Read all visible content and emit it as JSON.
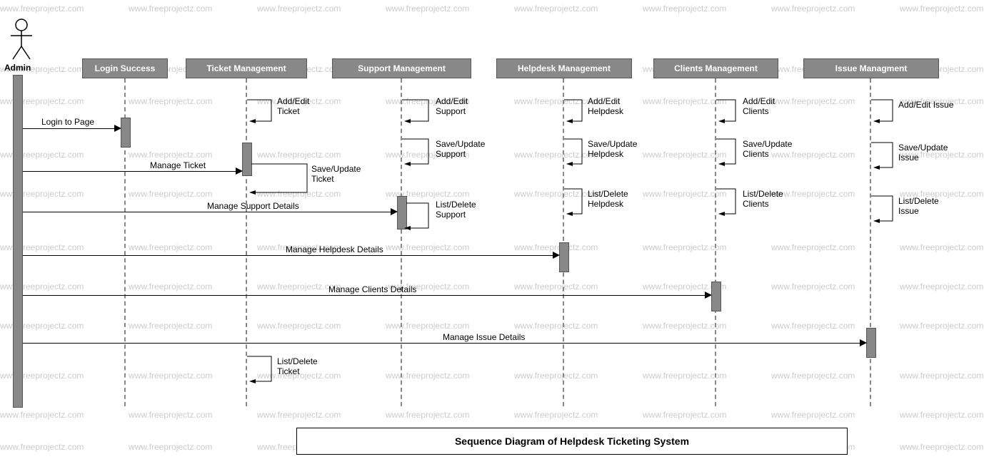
{
  "actor": {
    "name": "Admin"
  },
  "lifelines": [
    {
      "label": "Login Success"
    },
    {
      "label": "Ticket Management"
    },
    {
      "label": "Support Management"
    },
    {
      "label": "Helpdesk Management"
    },
    {
      "label": "Clients Management"
    },
    {
      "label": "Issue Managment"
    }
  ],
  "messages": {
    "login": "Login to Page",
    "manage_ticket": "Manage Ticket",
    "manage_support": "Manage Support Details",
    "manage_helpdesk": "Manage Helpdesk Details",
    "manage_clients": "Manage Clients Details",
    "manage_issue": "Manage Issue Details"
  },
  "self_calls": {
    "ticket_add": "Add/Edit\nTicket",
    "ticket_save": "Save/Update\nTicket",
    "ticket_list": "List/Delete\nTicket",
    "support_add": "Add/Edit\nSupport",
    "support_save": "Save/Update\nSupport",
    "support_list": "List/Delete\nSupport",
    "helpdesk_add": "Add/Edit\nHelpdesk",
    "helpdesk_save": "Save/Update\nHelpdesk",
    "helpdesk_list": "List/Delete\nHelpdesk",
    "clients_add": "Add/Edit\nClients",
    "clients_save": "Save/Update\nClients",
    "clients_list": "List/Delete\nClients",
    "issue_add": "Add/Edit Issue",
    "issue_save": "Save/Update\nIssue",
    "issue_list": "List/Delete\nIssue"
  },
  "title": "Sequence Diagram of Helpdesk Ticketing System",
  "watermark_text": "www.freeprojectz.com"
}
